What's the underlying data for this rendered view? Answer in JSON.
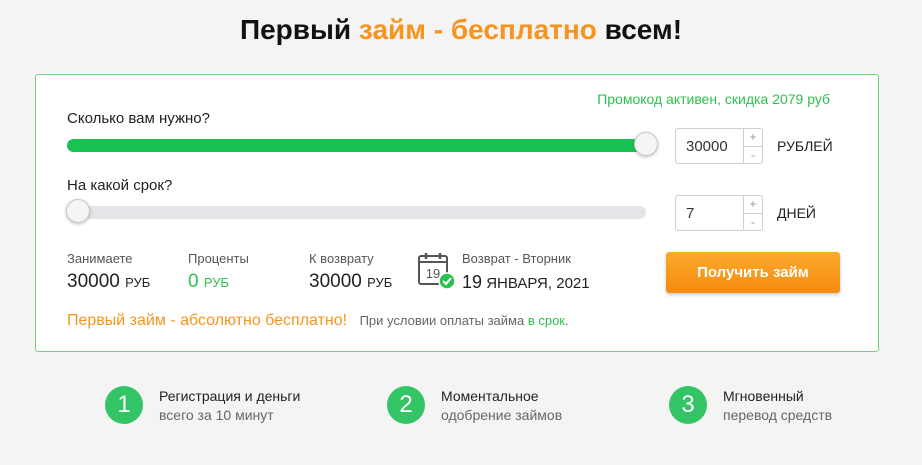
{
  "title": {
    "part1": "Первый ",
    "accent": "займ - бесплатно",
    "part2": " всем!"
  },
  "promo": "Промокод активен, скидка 2079 руб",
  "amount": {
    "question": "Сколько вам нужно?",
    "value": "30000",
    "unit": "РУБЛЕЙ",
    "slider_fraction": 1.0
  },
  "term": {
    "question": "На какой срок?",
    "value": "7",
    "unit": "ДНЕЙ",
    "slider_fraction": 0.0
  },
  "stepper": {
    "plus": "+",
    "minus": "-"
  },
  "stats": [
    {
      "label": "Занимаете",
      "value": "30000",
      "currency": "РУБ"
    },
    {
      "label": "Проценты",
      "value": "0",
      "currency": "РУБ"
    },
    {
      "label": "К возврату",
      "value": "30000",
      "currency": "РУБ"
    }
  ],
  "return": {
    "label": "Возврат - Вторник",
    "day": "19",
    "date_rest": "ЯНВАРЯ, 2021",
    "calendar_day": "19"
  },
  "cta": "Получить займ",
  "note": {
    "free": "Первый займ - абсолютно бесплатно!",
    "cond": "При условии оплаты займа",
    "cond_accent": "в срок",
    "cond_end": "."
  },
  "features": [
    {
      "num": "1",
      "line1": "Регистрация и деньги",
      "line2": "всего за 10 минут"
    },
    {
      "num": "2",
      "line1": "Моментальное",
      "line2": "одобрение займов"
    },
    {
      "num": "3",
      "line1": "Мгновенный",
      "line2": "перевод средств"
    }
  ],
  "colors": {
    "green": "#17c451",
    "orange": "#f7941d",
    "border": "#6fd37e"
  }
}
